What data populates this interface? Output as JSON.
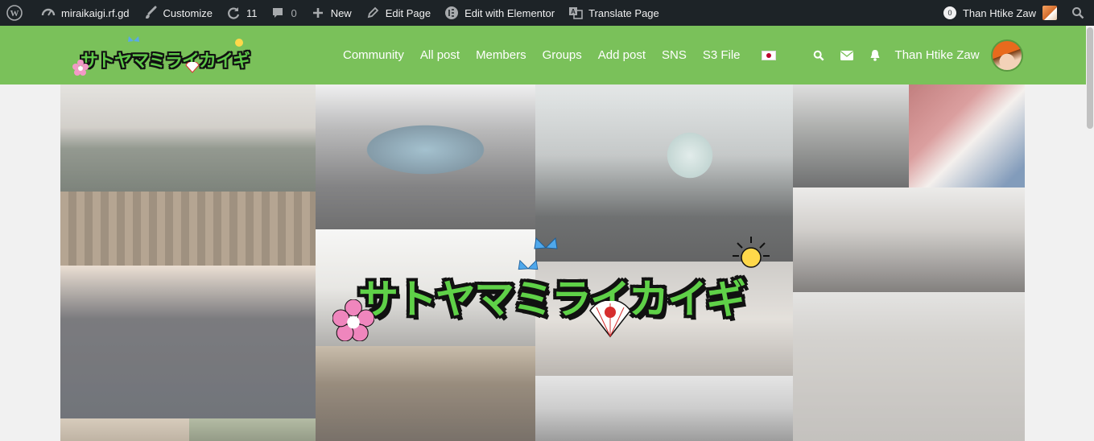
{
  "admin_bar": {
    "site_name": "miraikaigi.rf.gd",
    "customize": "Customize",
    "updates_count": "11",
    "comments_count": "0",
    "new": "New",
    "edit_page": "Edit Page",
    "edit_with_elementor": "Edit with Elementor",
    "translate_page": "Translate Page",
    "notifications_count": "0",
    "user_name": "Than Htike Zaw"
  },
  "header": {
    "logo_text": "サトヤマミライカイギ",
    "nav": [
      "Community",
      "All post",
      "Members",
      "Groups",
      "Add post",
      "SNS",
      "S3 File"
    ],
    "language": "Japanese",
    "user_name": "Than Htike Zaw"
  },
  "hero": {
    "logo_text": "サトヤマミライカイギ"
  },
  "colors": {
    "admin_bar_bg": "#1d2327",
    "header_bg": "#7ac15a",
    "logo_green": "#5fd148",
    "page_bg": "#f1f1f1"
  },
  "icons": [
    "wordpress-icon",
    "dashboard-icon",
    "brush-icon",
    "updates-icon",
    "comments-icon",
    "plus-icon",
    "pencil-icon",
    "elementor-icon",
    "translate-icon",
    "search-icon",
    "mail-icon",
    "bell-icon"
  ]
}
